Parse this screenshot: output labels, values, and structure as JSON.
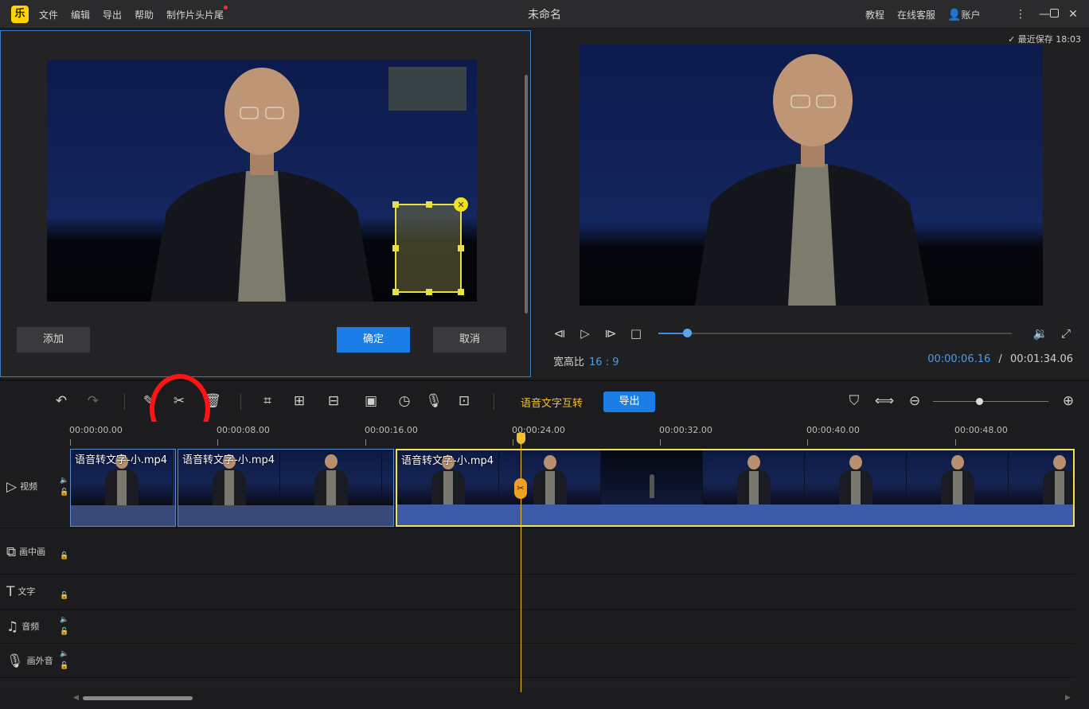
{
  "titlebar": {
    "logo": "乐",
    "menus": [
      "文件",
      "编辑",
      "导出",
      "帮助",
      "制作片头片尾"
    ],
    "title": "未命名",
    "right": [
      "教程",
      "在线客服",
      "账户"
    ]
  },
  "editor": {
    "add_label": "添加",
    "confirm_label": "确定",
    "cancel_label": "取消"
  },
  "preview": {
    "saved_text": "最近保存 18:03",
    "aspect_label": "宽高比",
    "aspect_value": "16 : 9",
    "current_time": "00:00:06.16",
    "separator": "/",
    "total_time": "00:01:34.06",
    "progress": 0.08
  },
  "toolbar": {
    "speech_text_label": "语音文字互转",
    "export_label": "导出",
    "zoom": 0.4
  },
  "ruler": {
    "ticks": [
      "00:00:00.00",
      "00:00:08.00",
      "00:00:16.00",
      "00:00:24.00",
      "00:00:32.00",
      "00:00:40.00",
      "00:00:48.00"
    ]
  },
  "tracks": [
    {
      "label": "视频"
    },
    {
      "label": "画中画"
    },
    {
      "label": "文字"
    },
    {
      "label": "音频"
    },
    {
      "label": "画外音"
    }
  ],
  "clips": [
    {
      "name": "语音转文字-小.mp4"
    },
    {
      "name": "语音转文字-小.mp4"
    },
    {
      "name": "语音转文字-小.mp4"
    }
  ],
  "icons": {
    "undo": "undo-icon",
    "redo": "redo-icon",
    "edit": "pencil-icon",
    "cut": "scissors-icon",
    "delete": "trash-icon",
    "crop": "crop-icon",
    "zoom": "zoom-frame-icon",
    "mosaic": "mosaic-icon",
    "freeze": "freeze-frame-icon",
    "duration": "clock-icon",
    "record": "mic-icon",
    "screen": "screen-record-icon"
  }
}
